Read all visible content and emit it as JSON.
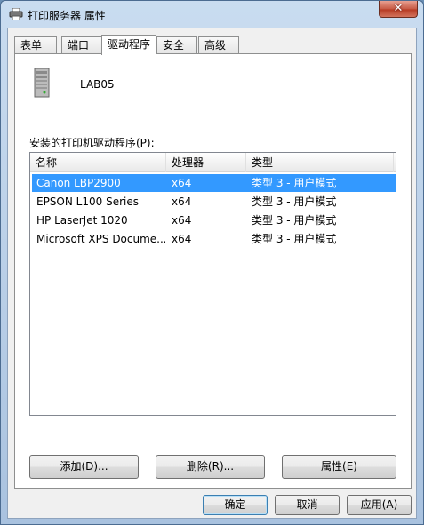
{
  "window": {
    "title": "打印服务器 属性",
    "close_label": "✕"
  },
  "tabs": [
    {
      "label": "表单"
    },
    {
      "label": "端口"
    },
    {
      "label": "驱动程序",
      "active": true
    },
    {
      "label": "安全"
    },
    {
      "label": "高级"
    }
  ],
  "server": {
    "name": "LAB05",
    "icon": "server-computer-icon"
  },
  "drivers": {
    "label": "安装的打印机驱动程序(P):",
    "columns": [
      "名称",
      "处理器",
      "类型"
    ],
    "rows": [
      {
        "name": "Canon LBP2900",
        "processor": "x64",
        "type": "类型 3 - 用户模式",
        "selected": true
      },
      {
        "name": "EPSON L100 Series",
        "processor": "x64",
        "type": "类型 3 - 用户模式"
      },
      {
        "name": "HP LaserJet 1020",
        "processor": "x64",
        "type": "类型 3 - 用户模式"
      },
      {
        "name": "Microsoft XPS Docume...",
        "processor": "x64",
        "type": "类型 3 - 用户模式"
      }
    ]
  },
  "actions": {
    "add": "添加(D)...",
    "remove": "删除(R)...",
    "properties": "属性(E)"
  },
  "footer": {
    "ok": "确定",
    "cancel": "取消",
    "apply": "应用(A)"
  },
  "colors": {
    "selection": "#3399ff",
    "titlebar": "#b7cde6",
    "close_button": "#c75a45"
  }
}
